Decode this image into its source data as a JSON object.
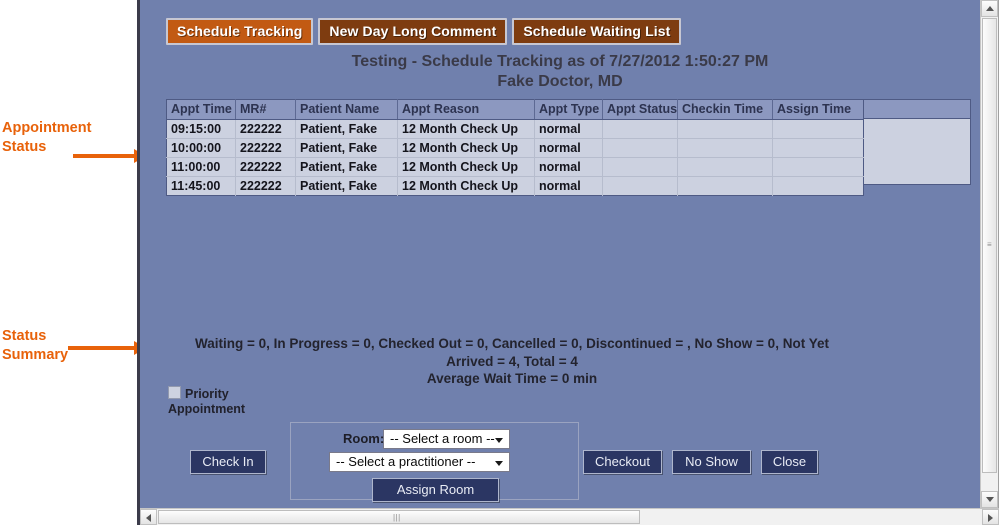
{
  "annotations": [
    {
      "id": "appointment-status",
      "text": "Appointment\nStatus"
    },
    {
      "id": "status-summary",
      "text": "Status\nSummary"
    }
  ],
  "accent_color": "#e8620a",
  "page_background": "#7080ad",
  "tabs": [
    {
      "label": "Schedule Tracking",
      "active": true,
      "color": "#c25a13"
    },
    {
      "label": "New Day Long Comment",
      "active": false,
      "color": "#7e3c10"
    },
    {
      "label": "Schedule Waiting List",
      "active": false,
      "color": "#7e3c10"
    }
  ],
  "heading": {
    "line1": "Testing - Schedule Tracking as of 7/27/2012 1:50:27 PM",
    "line2": "Fake Doctor, MD"
  },
  "grid": {
    "columns": [
      "Appt Time",
      "MR#",
      "Patient Name",
      "Appt Reason",
      "Appt Type",
      "Appt Status",
      "Checkin Time",
      "Assign Time"
    ],
    "rows": [
      [
        "09:15:00",
        "222222",
        "Patient, Fake",
        "12 Month Check Up",
        "normal",
        "",
        "",
        ""
      ],
      [
        "10:00:00",
        "222222",
        "Patient, Fake",
        "12 Month Check Up",
        "normal",
        "",
        "",
        ""
      ],
      [
        "11:00:00",
        "222222",
        "Patient, Fake",
        "12 Month Check Up",
        "normal",
        "",
        "",
        ""
      ],
      [
        "11:45:00",
        "222222",
        "Patient, Fake",
        "12 Month Check Up",
        "normal",
        "",
        "",
        ""
      ]
    ]
  },
  "summary": {
    "line1": "Waiting = 0, In Progress = 0, Checked Out = 0, Cancelled = 0, Discontinued = , No Show = 0, Not Yet",
    "line2": "Arrived = 4, Total = 4",
    "line3": "Average Wait Time = 0 min"
  },
  "priority": {
    "label": "Priority Appointment",
    "checked": false
  },
  "room_panel": {
    "room_label": "Room:",
    "room_select_value": "-- Select a room --",
    "practitioner_select_value": "-- Select a practitioner --",
    "assign_button": "Assign Room"
  },
  "buttons": {
    "check_in": "Check In",
    "checkout": "Checkout",
    "no_show": "No Show",
    "close": "Close"
  },
  "scrollbars": {
    "v_up": "scroll-up-arrow",
    "v_down": "scroll-down-arrow",
    "h_left": "scroll-left-arrow",
    "h_right": "scroll-right-arrow",
    "grip": "|||"
  }
}
